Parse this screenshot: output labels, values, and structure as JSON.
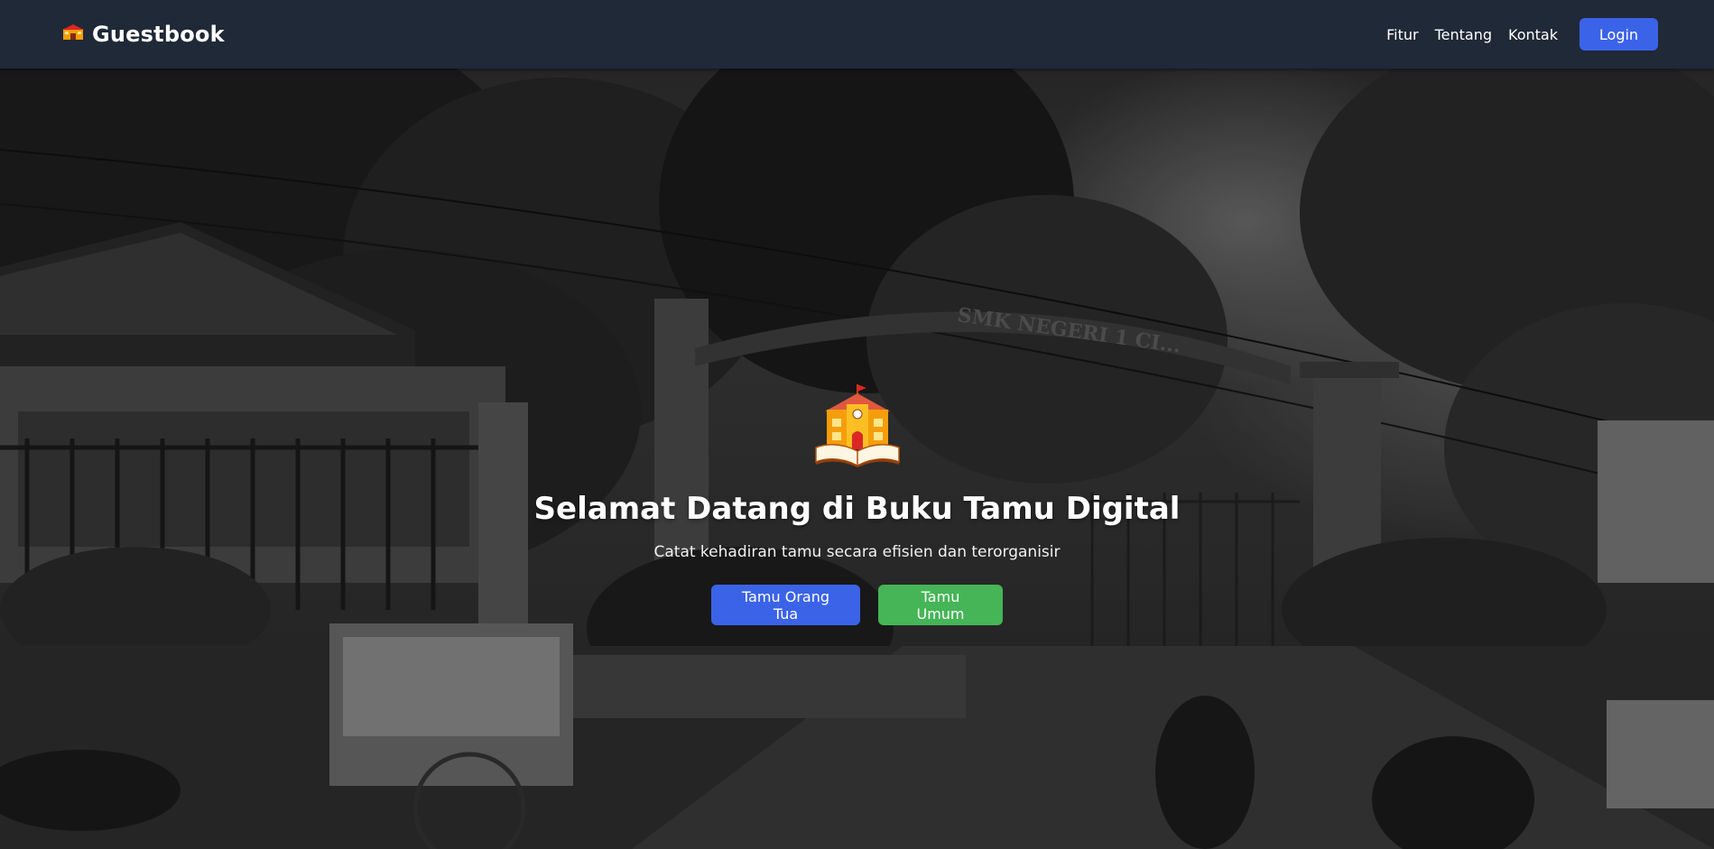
{
  "navbar": {
    "brand_icon": "school-icon",
    "brand_text": "Guestbook",
    "links": [
      "Fitur",
      "Tentang",
      "Kontak"
    ],
    "login_label": "Login",
    "background": "#1f2937"
  },
  "hero": {
    "background_photo": "school-gate-grayscale",
    "school_sign": "SMK NEGERI 1 CI...",
    "icon": "school-book-icon",
    "title": "Selamat Datang di Buku Tamu Digital",
    "subtitle": "Catat kehadiran tamu secara efisien dan terorganisir",
    "buttons": [
      {
        "label": "Tamu Orang Tua",
        "color": "#3b63e8"
      },
      {
        "label": "Tamu Umum",
        "color": "#45b557"
      }
    ]
  }
}
